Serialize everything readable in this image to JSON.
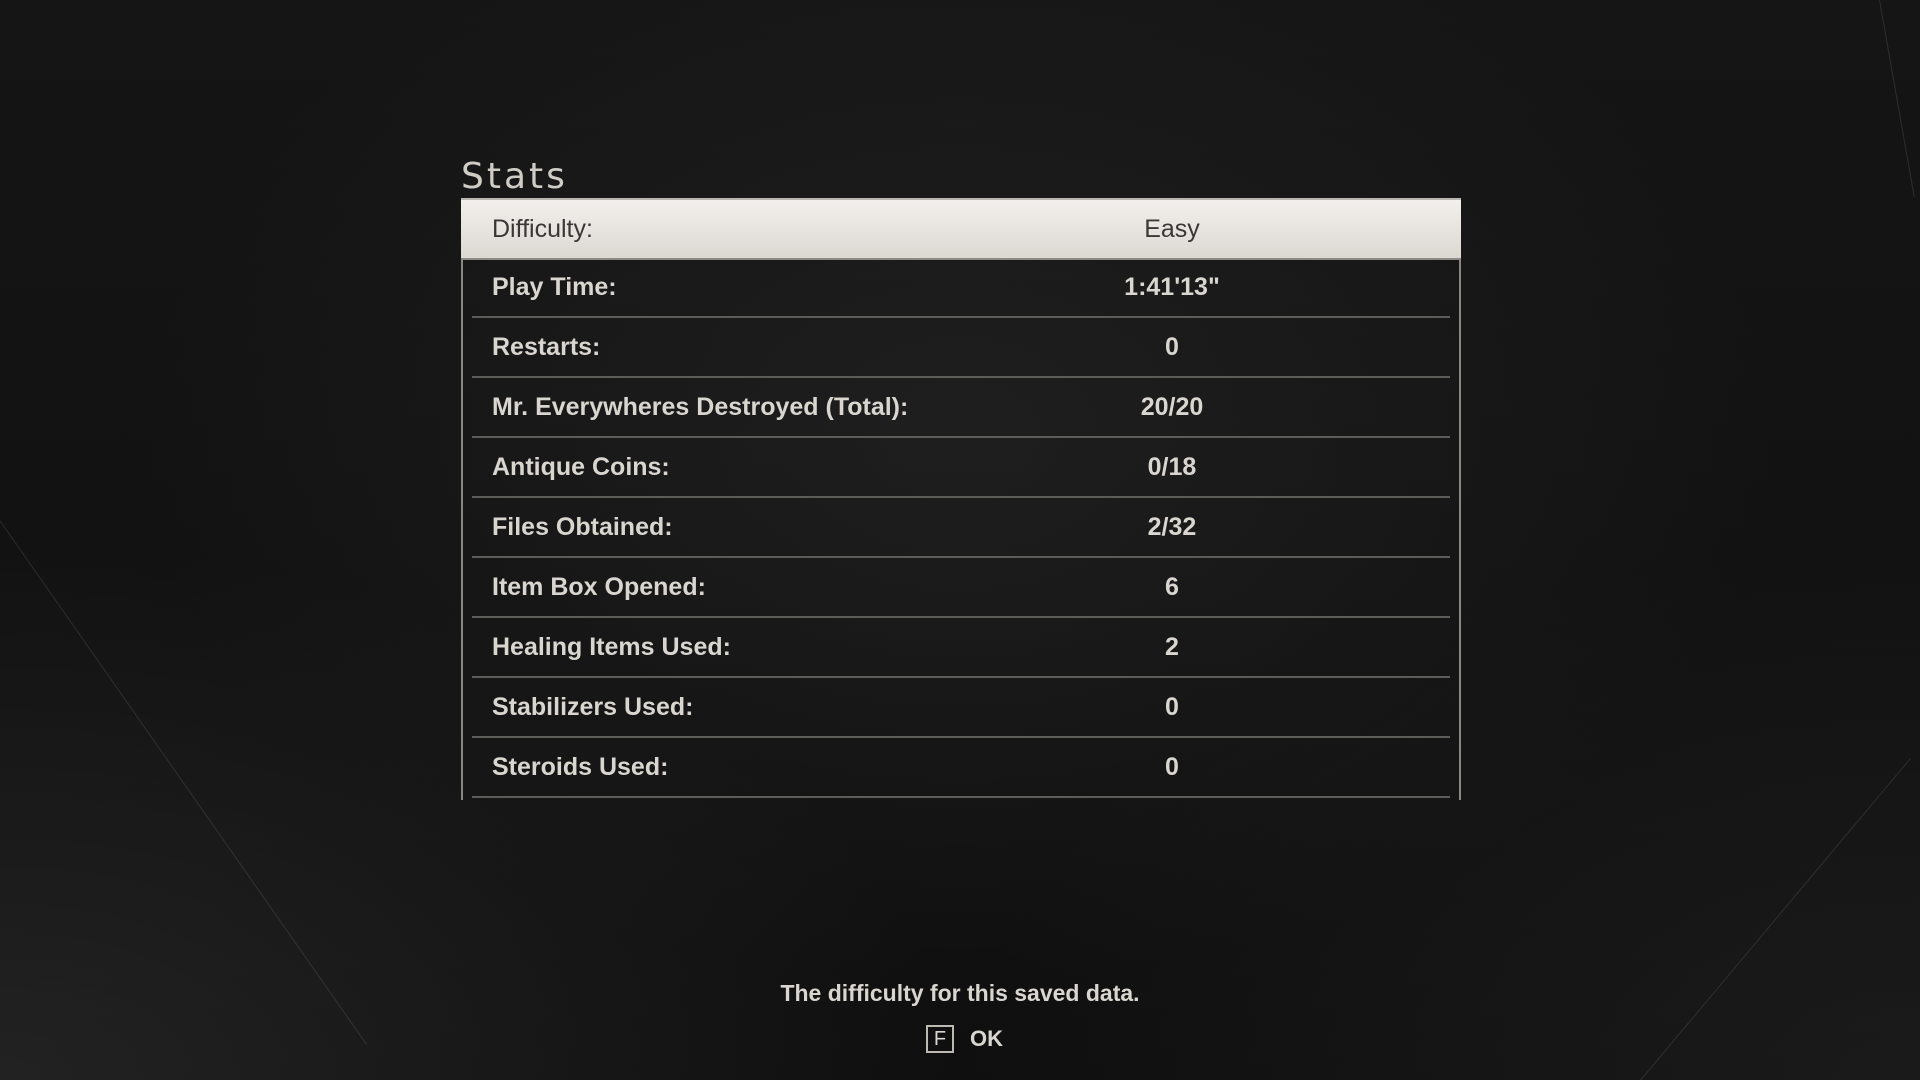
{
  "screen": {
    "title": "Stats"
  },
  "stats": [
    {
      "label": "Difficulty:",
      "value": "Easy"
    },
    {
      "label": "Play Time:",
      "value": "1:41'13\""
    },
    {
      "label": "Restarts:",
      "value": "0"
    },
    {
      "label": "Mr. Everywheres Destroyed (Total):",
      "value": "20/20"
    },
    {
      "label": "Antique Coins:",
      "value": "0/18"
    },
    {
      "label": "Files Obtained:",
      "value": "2/32"
    },
    {
      "label": "Item Box Opened:",
      "value": "6"
    },
    {
      "label": "Healing Items Used:",
      "value": "2"
    },
    {
      "label": "Stabilizers Used:",
      "value": "0"
    },
    {
      "label": "Steroids Used:",
      "value": "0"
    }
  ],
  "hint": "The difficulty for this saved data.",
  "controls": {
    "confirm_key": "F",
    "confirm_label": "OK"
  },
  "colors": {
    "background": "#121212",
    "text": "#d9d6d0",
    "selected_row_bg": "#f2f0ec",
    "selected_row_text": "#3a3836"
  }
}
